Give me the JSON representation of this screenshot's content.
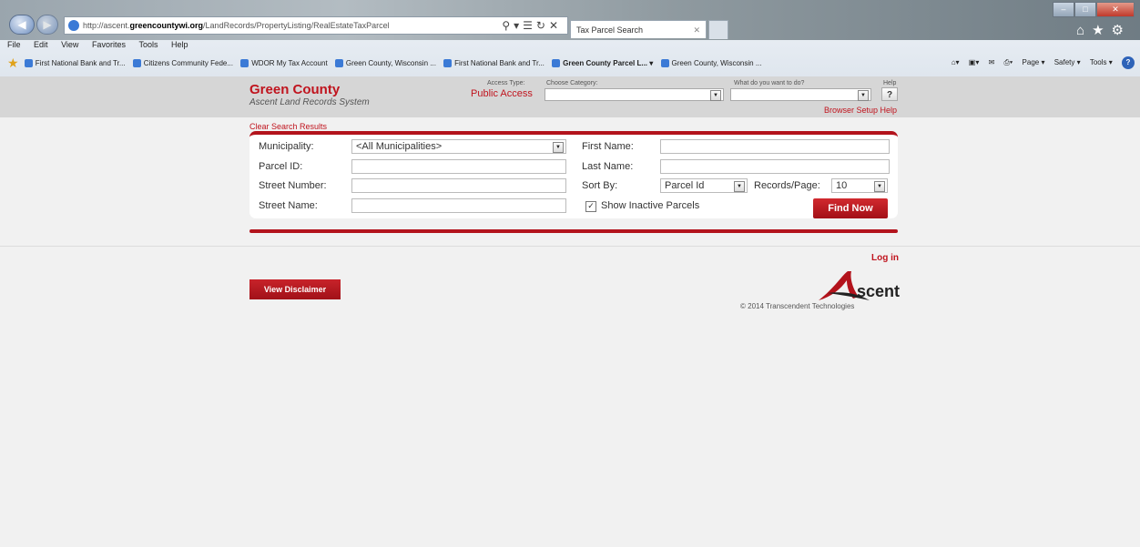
{
  "browser": {
    "url_prefix": "http://ascent.",
    "url_domain": "greencountywi.org",
    "url_path": "/LandRecords/PropertyListing/RealEstateTaxParcel",
    "tab_title": "Tax Parcel Search",
    "menu": [
      "File",
      "Edit",
      "View",
      "Favorites",
      "Tools",
      "Help"
    ],
    "favorites": [
      "First National Bank and Tr...",
      "Citizens Community Fede...",
      "WDOR My Tax Account",
      "Green County, Wisconsin ...",
      "First National Bank and Tr...",
      "Green County Parcel L... ▾",
      "Green County, Wisconsin ..."
    ],
    "commands": [
      "Page ▾",
      "Safety ▾",
      "Tools ▾"
    ]
  },
  "header": {
    "brand_title": "Green County",
    "brand_subtitle": "Ascent Land Records System",
    "access_type_label": "Access Type:",
    "access_type_value": "Public Access",
    "category_label": "Choose Category:",
    "todo_label": "What do you want to do?",
    "help_label": "Help",
    "help_button": "?",
    "browser_setup_help": "Browser Setup Help"
  },
  "search": {
    "clear_results": "Clear Search Results",
    "municipality_label": "Municipality:",
    "municipality_value": "<All Municipalities>",
    "parcel_id_label": "Parcel ID:",
    "street_number_label": "Street Number:",
    "street_name_label": "Street Name:",
    "first_name_label": "First Name:",
    "last_name_label": "Last Name:",
    "sort_by_label": "Sort By:",
    "sort_by_value": "Parcel Id",
    "records_per_page_label": "Records/Page:",
    "records_per_page_value": "10",
    "show_inactive_label": "Show Inactive Parcels",
    "find_now": "Find Now"
  },
  "footer": {
    "login": "Log in",
    "view_disclaimer": "View Disclaimer",
    "logo_text": "scent",
    "copyright": "© 2014 Transcendent Technologies"
  },
  "colors": {
    "brand_red": "#c0141e",
    "header_gray": "#d6d6d6"
  }
}
